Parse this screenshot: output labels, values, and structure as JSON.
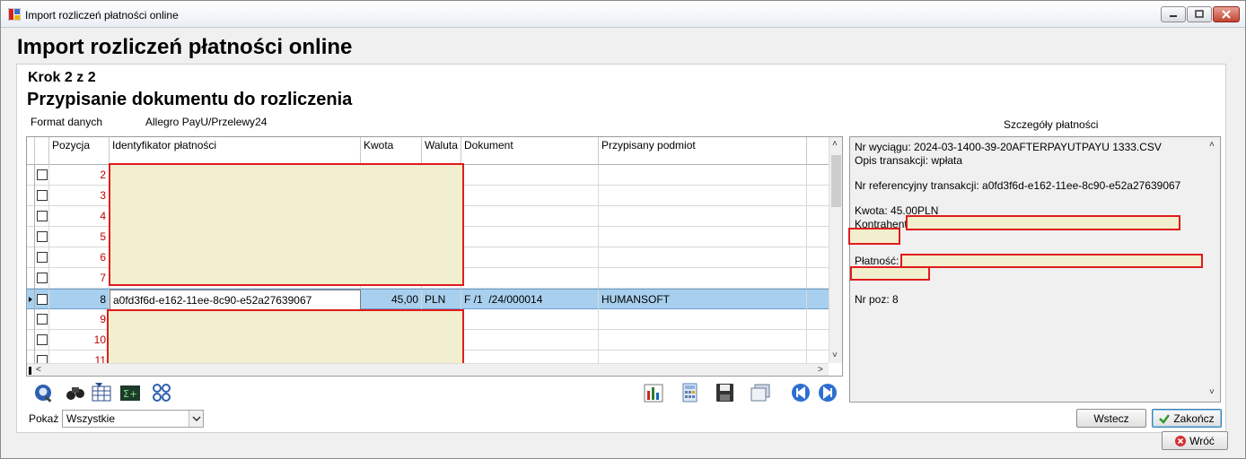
{
  "window": {
    "title": "Import rozliczeń płatności online"
  },
  "page": {
    "heading": "Import rozliczeń płatności online",
    "step": "Krok 2 z 2",
    "subheading": "Przypisanie dokumentu do rozliczenia",
    "format_label": "Format danych",
    "format_value": "Allegro PayU/Przelewy24",
    "details_title": "Szczegóły płatności"
  },
  "grid": {
    "columns": [
      "Pozycja",
      "Identyfikator płatności",
      "Kwota",
      "Waluta",
      "Dokument",
      "Przypisany podmiot"
    ],
    "rows_before": [
      "2",
      "3",
      "4",
      "5",
      "6",
      "7"
    ],
    "selected": {
      "pozycja": "8",
      "identyfikator": "a0fd3f6d-e162-11ee-8c90-e52a27639067",
      "kwota": "45,00",
      "waluta": "PLN",
      "dokument": "F /1  /24/000014",
      "podmiot": "HUMANSOFT"
    },
    "rows_after": [
      "9",
      "10",
      "11"
    ]
  },
  "toolbar": {
    "left_icons": [
      "search-doc-icon",
      "binoculars-icon",
      "filter-grid-icon",
      "sum-icon",
      "link-icon"
    ],
    "right_icons": [
      "chart-icon",
      "calculator-icon",
      "save-icon",
      "export-icon",
      "first-record-icon",
      "next-record-icon"
    ]
  },
  "filter": {
    "label": "Pokaż",
    "value": "Wszystkie"
  },
  "details": {
    "nr_wyciagu": "Nr wyciągu: 2024-03-1400-39-20AFTERPAYUTPAYU 1333.CSV",
    "opis": "Opis transakcji: wpłata",
    "nr_ref": "Nr referencyjny transakcji: a0fd3f6d-e162-11ee-8c90-e52a27639067",
    "kwota": "Kwota: 45.00PLN",
    "kontrahent": "Kontrahent:",
    "platnosc": "Płatność:",
    "nr_poz": "Nr poz: 8"
  },
  "buttons": {
    "wstecz": "Wstecz",
    "zakoncz": "Zakończ",
    "wroc": "Wróć"
  }
}
